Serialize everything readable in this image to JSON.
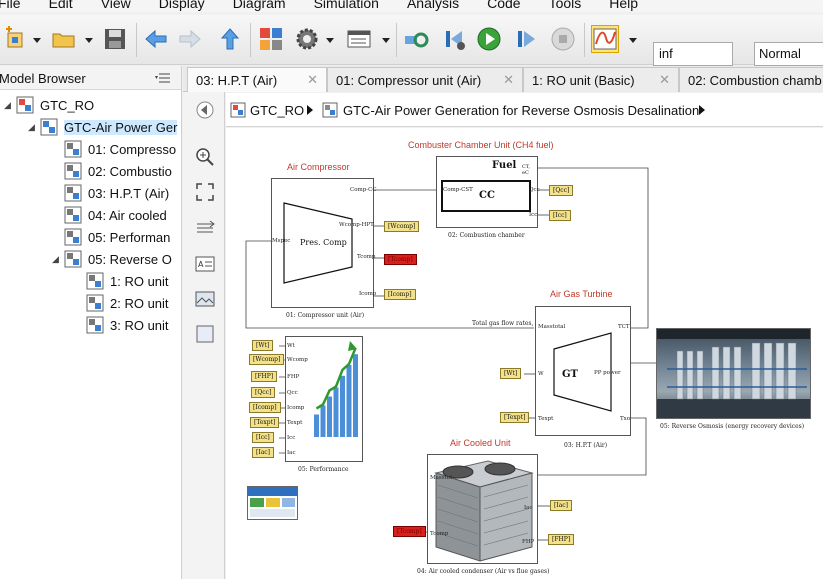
{
  "menu": [
    "File",
    "Edit",
    "View",
    "Display",
    "Diagram",
    "Simulation",
    "Analysis",
    "Code",
    "Tools",
    "Help"
  ],
  "toolbar": {
    "stop_time": "inf",
    "sim_mode": "Normal"
  },
  "browser": {
    "title": "Model Browser",
    "items": [
      {
        "label": "GTC_RO",
        "level": 0
      },
      {
        "label": "GTC-Air Power Ger",
        "level": 1
      },
      {
        "label": "01: Compresso",
        "level": 2
      },
      {
        "label": "02: Combustio",
        "level": 2
      },
      {
        "label": "03: H.P.T  (Air)",
        "level": 2
      },
      {
        "label": "04: Air cooled",
        "level": 2
      },
      {
        "label": "05: Performan",
        "level": 2
      },
      {
        "label": "05: Reverse O",
        "level": 2
      },
      {
        "label": "1: RO unit",
        "level": 3
      },
      {
        "label": "2: RO unit",
        "level": 3
      },
      {
        "label": "3: RO unit",
        "level": 3
      }
    ]
  },
  "tabs": [
    {
      "label": "03: H.P.T  (Air)"
    },
    {
      "label": "01: Compressor unit (Air)"
    },
    {
      "label": "1: RO unit (Basic)"
    },
    {
      "label": "02: Combustion chamb"
    }
  ],
  "breadcrumb": [
    "GTC_RO",
    "GTC-Air Power Generation for Reverse Osmosis Desalination"
  ],
  "diagram": {
    "compressor": {
      "title": "Air Compressor",
      "caption": "01: Compressor unit (Air)",
      "inner": "Pres. Comp",
      "ports": [
        "Comp-CC",
        "Wcomp-HPT",
        "Tcomp",
        "Icomp",
        "Mspec"
      ],
      "tags": [
        "[Wcomp]",
        "[Tcomp]",
        "[Icomp]"
      ]
    },
    "combustor": {
      "title": "Combuster Chamber Unit (CH4 fuel)",
      "caption": "02: Combustion chamber",
      "inner": "CC",
      "fuel_label": "Fuel",
      "fuel_sub": "CT, eC",
      "ports": [
        "Comp-CST",
        "Qcc",
        "Icc"
      ],
      "tags": [
        "[Qcc]",
        "[Icc]"
      ]
    },
    "turbine": {
      "title": "Air Gas Turbine",
      "caption": "03: H.P.T (Air)",
      "inner": "GT",
      "ports": [
        "Masstotal",
        "TCT",
        "W",
        "PP power",
        "Texpt",
        "Txo"
      ],
      "tags": [
        "[Wt]",
        "[Texpt]"
      ],
      "flow_label": "Total gas flow rates, kg/s"
    },
    "performance": {
      "caption": "05: Performance",
      "tags": [
        "[Wt]",
        "[Wcomp]",
        "[FHP]",
        "[Qcc]",
        "[Icomp]",
        "[Texpt]",
        "[Icc]",
        "[Iac]"
      ],
      "ports": [
        "Wt",
        "Wcomp",
        "FHP",
        "Qcc",
        "Icomp",
        "Texpt",
        "Icc",
        "Iac"
      ],
      "chart_bars": [
        0.25,
        0.35,
        0.45,
        0.55,
        0.68,
        0.8,
        0.92
      ]
    },
    "aircooler": {
      "title": "Air Cooled Unit",
      "caption": "04: Air cooled condenser (Air vs flue gases)",
      "ports": [
        "Masstot",
        "Tcomp",
        "Iac",
        "FHP"
      ],
      "tags": [
        "[Iac]",
        "[FHP]",
        "[Tcomp]"
      ]
    },
    "ro": {
      "caption": "05: Reverse Osmosis (energy recovery devices)"
    }
  }
}
